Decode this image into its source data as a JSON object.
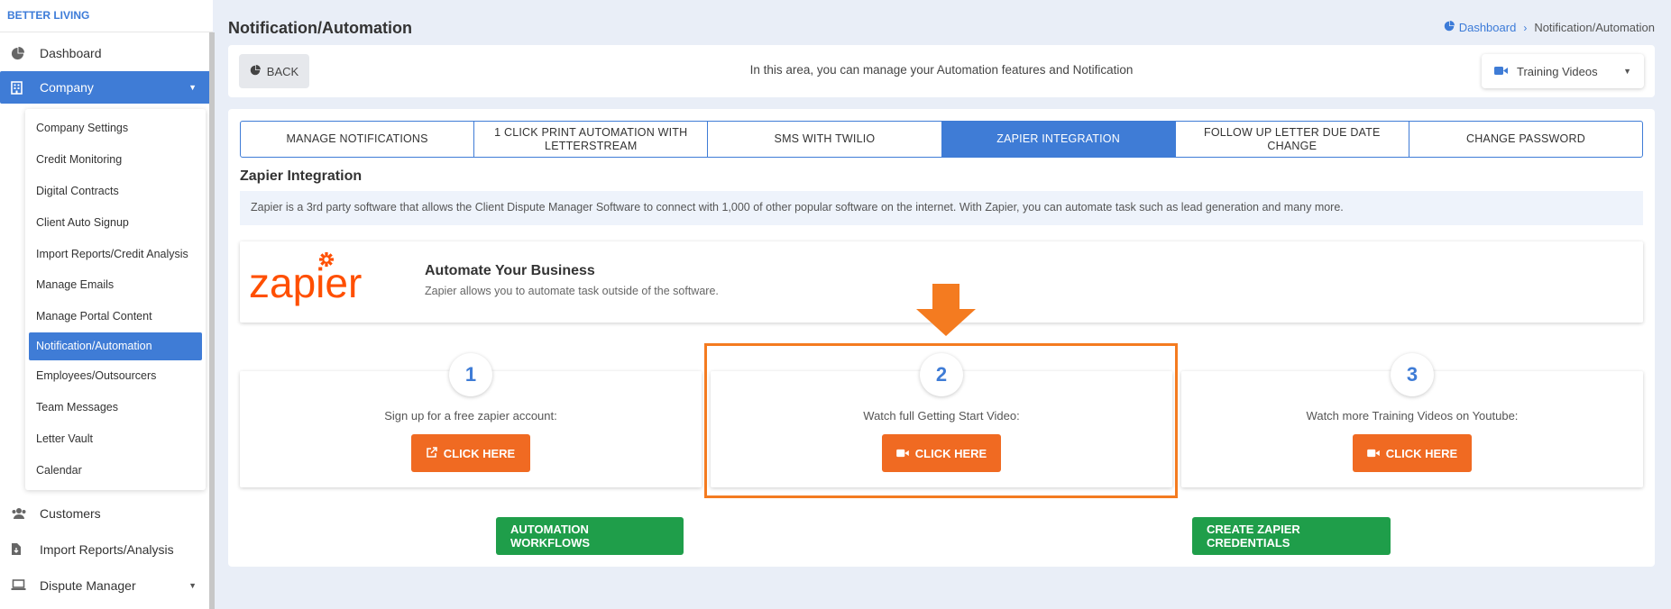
{
  "sidebar": {
    "brand": "BETTER LIVING",
    "items": [
      {
        "label": "Dashboard",
        "icon": "dashboard-icon"
      },
      {
        "label": "Company",
        "icon": "building-icon"
      },
      {
        "label": "Customers",
        "icon": "users-icon"
      },
      {
        "label": "Import Reports/Analysis",
        "icon": "file-import-icon"
      },
      {
        "label": "Dispute Manager",
        "icon": "laptop-icon"
      }
    ],
    "company_submenu": [
      "Company Settings",
      "Credit Monitoring",
      "Digital Contracts",
      "Client Auto Signup",
      "Import Reports/Credit Analysis",
      "Manage Emails",
      "Manage Portal Content",
      "Notification/Automation",
      "Employees/Outsourcers",
      "Team Messages",
      "Letter Vault",
      "Calendar"
    ]
  },
  "header": {
    "title": "Notification/Automation",
    "breadcrumb": {
      "home": "Dashboard",
      "current": "Notification/Automation"
    }
  },
  "topbar": {
    "back_label": "BACK",
    "info": "In this area, you can manage your Automation features and Notification",
    "video_select": "Training Videos"
  },
  "tabs": [
    "MANAGE NOTIFICATIONS",
    "1 CLICK PRINT AUTOMATION WITH LETTERSTREAM",
    "SMS WITH TWILIO",
    "ZAPIER INTEGRATION",
    "FOLLOW UP LETTER DUE DATE CHANGE",
    "CHANGE PASSWORD"
  ],
  "active_tab": "ZAPIER INTEGRATION",
  "zapier": {
    "section_title": "Zapier Integration",
    "description": "Zapier is a 3rd party software that allows the Client Dispute Manager Software to connect with 1,000 of other popular software on the internet. With Zapier, you can automate task such as lead generation and many more.",
    "logo_text": "zapier",
    "automate_title": "Automate Your Business",
    "automate_sub": "Zapier allows you to automate task outside of the software.",
    "steps": [
      {
        "number": "1",
        "text": "Sign up for a free zapier account:",
        "button": "CLICK HERE",
        "icon": "external-link-icon"
      },
      {
        "number": "2",
        "text": "Watch full Getting Start Video:",
        "button": "CLICK HERE",
        "icon": "video-camera-icon"
      },
      {
        "number": "3",
        "text": "Watch more Training Videos on Youtube:",
        "button": "CLICK HERE",
        "icon": "video-camera-icon"
      }
    ],
    "automation_workflows": "AUTOMATION WORKFLOWS",
    "create_credentials": "CREATE ZAPIER CREDENTIALS"
  },
  "colors": {
    "primary": "#3f7cd6",
    "orange": "#f06a22",
    "green": "#1f9e4a",
    "highlight": "#f47b20"
  }
}
